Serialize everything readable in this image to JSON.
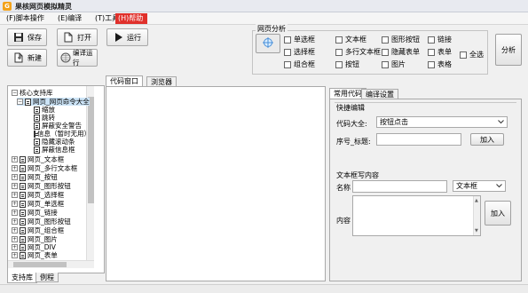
{
  "window": {
    "title": "果核网页模拟精灵",
    "app_icon_char": "G"
  },
  "menu": [
    {
      "label": "(F)脚本操作",
      "active": false
    },
    {
      "label": "(E)编译",
      "active": false
    },
    {
      "label": "(T)工具",
      "active": false
    },
    {
      "label": "(H)帮助",
      "active": true
    }
  ],
  "toolbar": {
    "save": "保存",
    "open": "打开",
    "run": "运行",
    "new": "新建",
    "compile_run": "编译运行"
  },
  "web_analysis": {
    "title": "网页分析",
    "checkboxes": [
      [
        "单选框",
        "文本框",
        "图形按钮",
        "链接"
      ],
      [
        "选择框",
        "多行文本框",
        "隐藏表单",
        "表单"
      ],
      [
        "组合框",
        "按钮",
        "图片",
        "表格"
      ]
    ],
    "select_all": "全选",
    "analyze_button": "分析"
  },
  "left_panel": {
    "root": "核心支持库",
    "open_node": "网页_网页命令大全",
    "children": [
      "缩放",
      "跳转",
      "屏蔽安全警告",
      "信息（暂时无用）",
      "隐藏滚动条",
      "屏蔽信息框"
    ],
    "nodes": [
      "网页_文本框",
      "网页_多行文本框",
      "网页_按钮",
      "网页_图形按钮",
      "网页_选择框",
      "网页_单选框",
      "网页_链接",
      "网页_图形按钮",
      "网页_组合框",
      "网页_图片",
      "网页_DIV",
      "网页_表单"
    ],
    "tabs": [
      "支持库",
      "例程"
    ]
  },
  "center_tabs": [
    "代码窗口",
    "浏览器"
  ],
  "right_panel": {
    "tabs": [
      "常用代码",
      "编译设置"
    ],
    "quick_edit_title": "快捷编辑",
    "code_label": "代码大全:",
    "code_value": "按钮点击",
    "seq_label": "序号_标题:",
    "seq_value": "",
    "add_button": "加入",
    "write_title": "文本框写内容",
    "name_label": "名称",
    "name_value": "",
    "type_value": "文本框",
    "content_label": "内容",
    "content_value": "",
    "add_button2": "加入"
  }
}
